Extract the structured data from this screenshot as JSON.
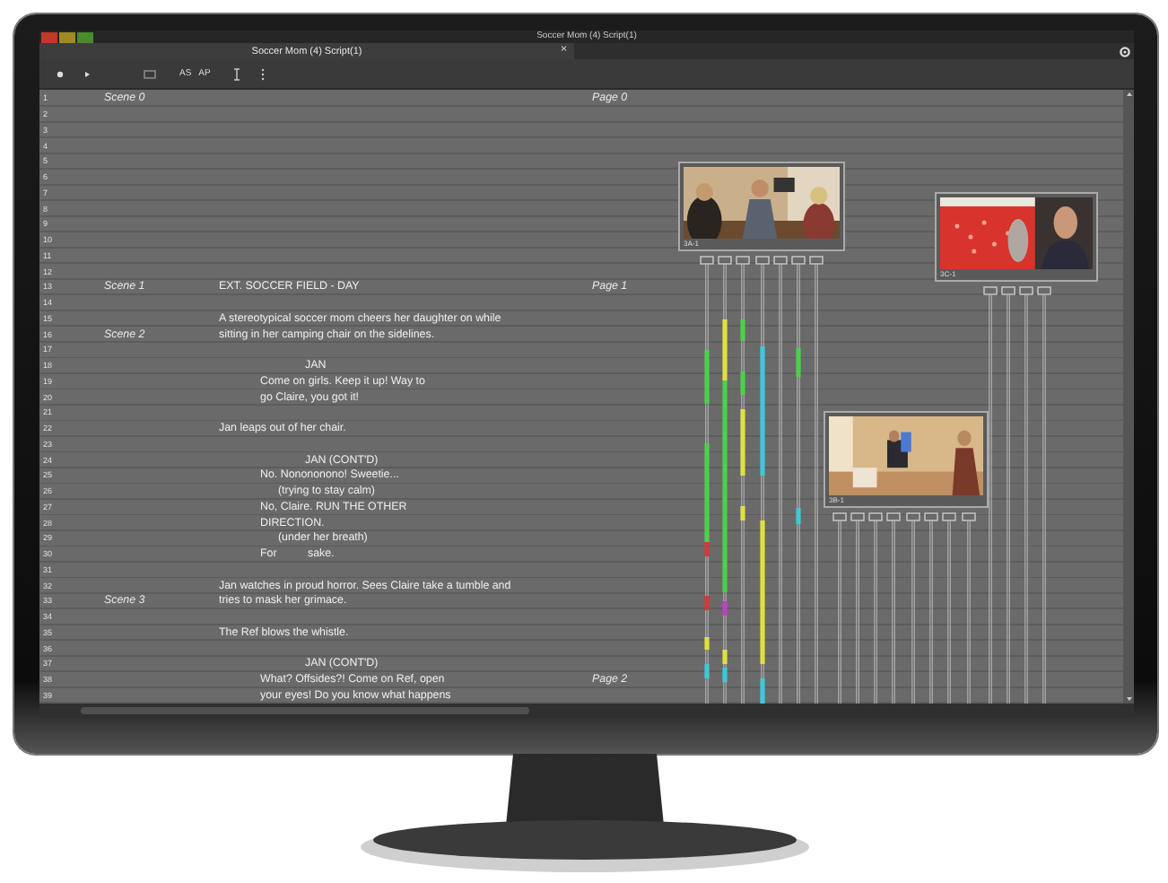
{
  "window": {
    "title": "Soccer Mom (4) Script(1)"
  },
  "tabs": [
    {
      "label": "Soccer Mom (4) Script(1)",
      "close": "×",
      "selected": true
    }
  ],
  "toolbar": [
    {
      "kind": "record"
    },
    {
      "kind": "play"
    },
    {
      "kind": "clip"
    },
    {
      "kind": "text",
      "label": "AS"
    },
    {
      "kind": "text",
      "label": "AP"
    },
    {
      "kind": "cursor"
    },
    {
      "kind": "dots"
    }
  ],
  "script": {
    "rows": [
      {
        "number": "1",
        "scene": "Scene 0",
        "page": "Page 0"
      },
      {
        "number": "2"
      },
      {
        "number": "3"
      },
      {
        "number": "4"
      },
      {
        "number": "5"
      },
      {
        "number": "6"
      },
      {
        "number": "7"
      },
      {
        "number": "8"
      },
      {
        "number": "9"
      },
      {
        "number": "10"
      },
      {
        "number": "11"
      },
      {
        "number": "12"
      },
      {
        "number": "13",
        "scene": "Scene 1",
        "kind": "heading",
        "text": "EXT. SOCCER FIELD - DAY",
        "page": "Page 1"
      },
      {
        "number": "14"
      },
      {
        "number": "15",
        "kind": "action",
        "text": "A stereotypical soccer mom cheers her daughter on while"
      },
      {
        "number": "16",
        "scene": "Scene 2",
        "kind": "action",
        "text": "sitting in her camping chair on the sidelines."
      },
      {
        "number": "17"
      },
      {
        "number": "18",
        "kind": "character",
        "text": "JAN"
      },
      {
        "number": "19",
        "kind": "dialogue",
        "text": "Come on girls. Keep it up! Way to"
      },
      {
        "number": "20",
        "kind": "dialogue",
        "text": "go Claire, you got it!"
      },
      {
        "number": "21"
      },
      {
        "number": "22",
        "kind": "action",
        "text": "Jan leaps out of her chair."
      },
      {
        "number": "23"
      },
      {
        "number": "24",
        "kind": "character",
        "text": "JAN (CONT'D)"
      },
      {
        "number": "25",
        "kind": "dialogue",
        "text": "No. Nonononono! Sweetie..."
      },
      {
        "number": "26",
        "kind": "paren",
        "text": "(trying to stay calm)"
      },
      {
        "number": "27",
        "kind": "dialogue",
        "text": "No, Claire. RUN THE OTHER"
      },
      {
        "number": "28",
        "kind": "dialogue",
        "text": "DIRECTION."
      },
      {
        "number": "29",
        "kind": "paren",
        "text": "(under her breath)"
      },
      {
        "number": "30",
        "kind": "dialogue",
        "text": "For          sake."
      },
      {
        "number": "31"
      },
      {
        "number": "32",
        "kind": "action",
        "text": "Jan watches in proud horror. Sees Claire take a tumble and"
      },
      {
        "number": "33",
        "scene": "Scene 3",
        "kind": "action",
        "text": "tries to mask her grimace."
      },
      {
        "number": "34"
      },
      {
        "number": "35",
        "kind": "action",
        "text": "The Ref blows the whistle."
      },
      {
        "number": "36"
      },
      {
        "number": "37",
        "kind": "character",
        "text": "JAN (CONT'D)"
      },
      {
        "number": "38",
        "kind": "dialogue",
        "text": "What? Offsides?! Come on Ref, open",
        "page": "Page 2"
      },
      {
        "number": "39",
        "kind": "dialogue",
        "text": "your eyes! Do you know what happens"
      }
    ]
  },
  "timeline": {
    "clips": [
      {
        "label": "3A-1",
        "kind": "picture"
      },
      {
        "label": "3C-1",
        "kind": "picture"
      },
      {
        "label": "3B-1",
        "kind": "picture"
      }
    ]
  }
}
